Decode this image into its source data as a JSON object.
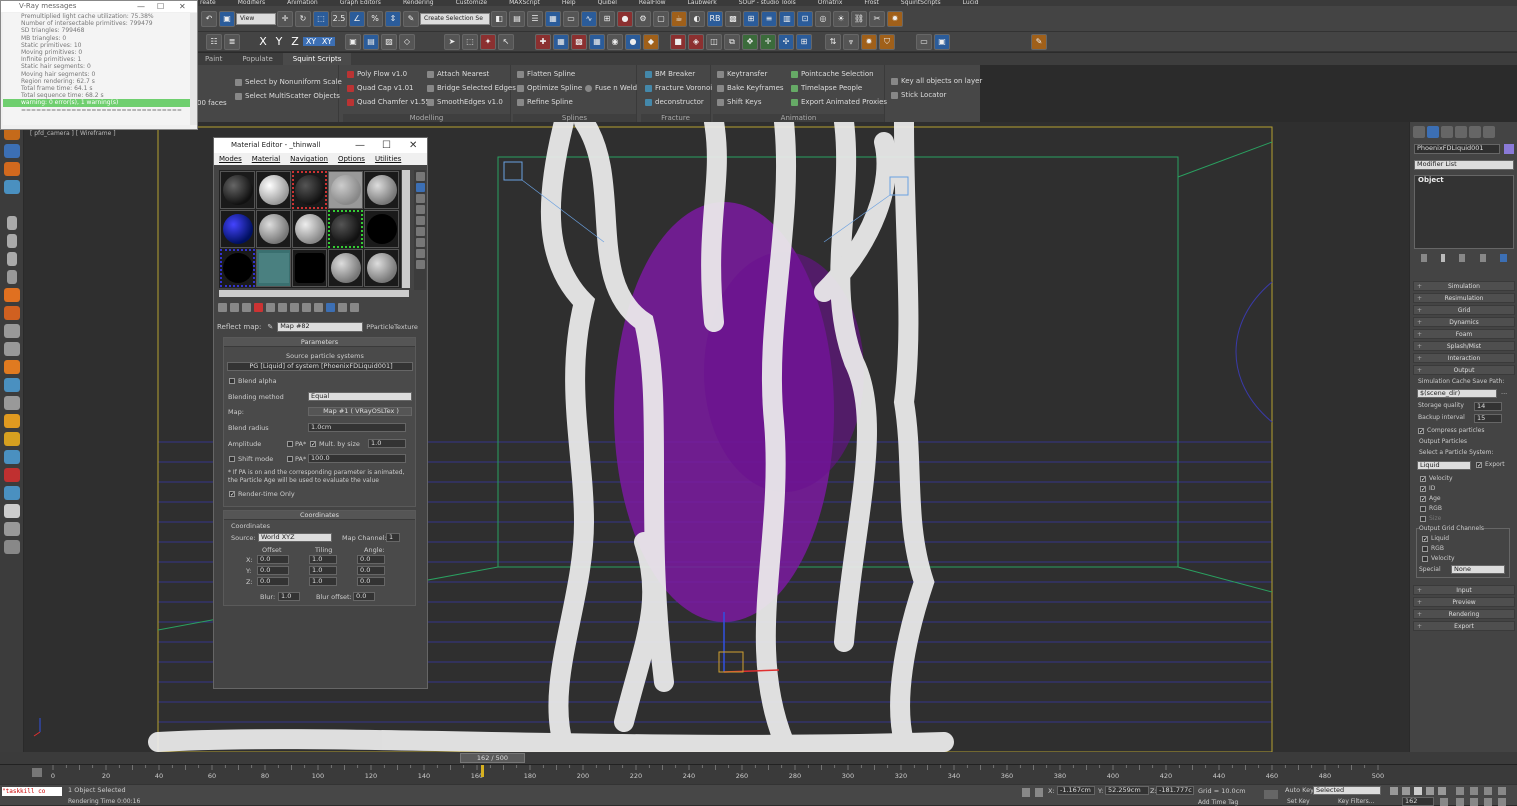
{
  "menus": [
    "reate",
    "Modifiers",
    "Animation",
    "Graph Editors",
    "Rendering",
    "Customize",
    "MAXScript",
    "Help",
    "Quibel",
    "RealFlow",
    "Laubwerk",
    "SOuP - studio Tools",
    "Ornatrix",
    "Frost",
    "SquintScripts",
    "Lucid"
  ],
  "main_toolbar": {
    "view_dropdown": "View",
    "selection_set_dropdown": "Create Selection Se",
    "snap_label": "2.5",
    "rb_label": "RB"
  },
  "axes": [
    "X",
    "Y",
    "Z",
    "XY",
    "XY"
  ],
  "ribbon": {
    "tabs": [
      "Paint",
      "Populate",
      "Squint Scripts"
    ],
    "faces_label": "00 faces",
    "groups": [
      {
        "label": "",
        "items": [
          "Select by Nonuniform Scale",
          "Select MultiScatter Objects"
        ]
      },
      {
        "label": "Modelling",
        "items": [
          "Poly Flow v1.0",
          "Quad Cap v1.01",
          "Quad Chamfer v1.55",
          "Attach Nearest",
          "Bridge Selected Edges",
          "SmoothEdges v1.0"
        ]
      },
      {
        "label": "Splines",
        "items": [
          "Flatten Spline",
          "Optimize Spline",
          "Refine Spline",
          "Fuse n Weld"
        ]
      },
      {
        "label": "Fracture",
        "items": [
          "BM Breaker",
          "Fracture Voronoi",
          "deconstructor"
        ]
      },
      {
        "label": "Animation",
        "items": [
          "Keytransfer",
          "Bake Keyframes",
          "Shift Keys",
          "Pointcache Selection",
          "Timelapse People",
          "Export Animated Proxies"
        ]
      },
      {
        "label": "",
        "items": [
          "Key all objects on layer",
          "Stick Locator"
        ]
      }
    ]
  },
  "vray_messages": {
    "title": "V-Ray messages",
    "lines": [
      "Premultiplied light cache utilization: 75.38%",
      "Number of intersectable primitives: 799479",
      "SD triangles: 799468",
      "MB triangles: 0",
      "Static primitives: 10",
      "Moving primitives: 0",
      "Infinite primitives: 1",
      "Static hair segments: 0",
      "Moving hair segments: 0",
      "Region rendering: 62.7 s",
      "Total frame time: 64.1 s",
      "Total sequence time: 68.2 s"
    ],
    "warning_line": "warning: 0 error(s), 1 warning(s)",
    "separator": "================================"
  },
  "viewport_label": "[ pfd_camera ] [ Wireframe ]",
  "material_editor": {
    "title": "Material Editor - _thinwall",
    "menu": [
      "Modes",
      "Material",
      "Navigation",
      "Options",
      "Utilities"
    ],
    "reflect_label": "Reflect map:",
    "map_name": "Map #82",
    "map_type": "PParticleTexture",
    "parameters": {
      "header": "Parameters",
      "source_label": "Source particle systems",
      "source_value": "PG [Liquid] of system [PhoenixFDLiquid001]",
      "blend_alpha": "Blend alpha",
      "blending_method_label": "Blending method",
      "blending_method_value": "Equal",
      "map_label": "Map:",
      "map_value": "Map #1  ( VRayOSLTex )",
      "blend_radius_label": "Blend radius",
      "blend_radius_value": "1.0cm",
      "amplitude_label": "Amplitude",
      "pa_label": "PA*",
      "mult_by_size": "Mult. by size",
      "amplitude_value": "1.0",
      "shift_mode_label": "Shift mode",
      "shift_value": "100.0",
      "note": "* If PA is on and the corresponding parameter is animated, the Particle Age will be used to evaluate the value",
      "render_time_only": "Render-time Only"
    },
    "coordinates": {
      "header": "Coordinates",
      "group": "Coordinates",
      "source_label": "Source:",
      "source_value": "World XYZ",
      "map_channel_label": "Map Channel:",
      "map_channel_value": "1",
      "offset_label": "Offset",
      "tiling_label": "Tiling",
      "angle_label": "Angle:",
      "rows": [
        {
          "axis": "X:",
          "offset": "0.0",
          "tiling": "1.0",
          "angle": "0.0"
        },
        {
          "axis": "Y:",
          "offset": "0.0",
          "tiling": "1.0",
          "angle": "0.0"
        },
        {
          "axis": "Z:",
          "offset": "0.0",
          "tiling": "1.0",
          "angle": "0.0"
        }
      ],
      "blur_label": "Blur:",
      "blur_value": "1.0",
      "blur_offset_label": "Blur offset:",
      "blur_offset_value": "0.0"
    }
  },
  "command_panel": {
    "object_name": "PhoenixFDLiquid001",
    "modifier_list": "Modifier List",
    "stack_item": "Object",
    "rollouts_top": [
      "Simulation",
      "Resimulation",
      "Grid",
      "Dynamics",
      "Foam",
      "Splash/Mist",
      "Interaction",
      "Output"
    ],
    "cache_path_label": "Simulation Cache Save Path:",
    "cache_path_value": "$(scene_dir)",
    "storage_quality_label": "Storage quality",
    "storage_quality_value": "14",
    "backup_interval_label": "Backup interval",
    "backup_interval_value": "15",
    "compress_particles": "Compress particles",
    "output_particles": "Output Particles",
    "select_particle_system": "Select a Particle System:",
    "particle_system_value": "Liquid",
    "export_label": "Export",
    "particle_channels": [
      "Velocity",
      "ID",
      "Age",
      "RGB",
      "Size"
    ],
    "output_grid_channels": "Output Grid Channels",
    "grid_channels": [
      "Liquid",
      "RGB",
      "Velocity"
    ],
    "special_label": "Special",
    "special_value": "None",
    "rollouts_bottom": [
      "Input",
      "Preview",
      "Rendering",
      "Export"
    ]
  },
  "timeline": {
    "frame_display": "162 / 500",
    "ticks": [
      "0",
      "20",
      "40",
      "60",
      "80",
      "100",
      "120",
      "140",
      "160",
      "180",
      "200",
      "220",
      "240",
      "260",
      "280",
      "300",
      "320",
      "340",
      "360",
      "380",
      "400",
      "420",
      "440",
      "460",
      "480",
      "500"
    ]
  },
  "status": {
    "maxscript_text": "\"taskkill co",
    "selection": "1 Object Selected",
    "render_time": "Rendering Time  0:00:16",
    "x_label": "X:",
    "x_value": "-1.167cm",
    "y_label": "Y:",
    "y_value": "52.259cm",
    "z_label": "Z:",
    "z_value": "-181.777c",
    "grid": "Grid = 10.0cm",
    "add_time_tag": "Add Time Tag",
    "auto_key": "Auto Key",
    "set_key": "Set Key",
    "selected": "Selected",
    "key_filters": "Key Filters...",
    "frame_field": "162"
  }
}
